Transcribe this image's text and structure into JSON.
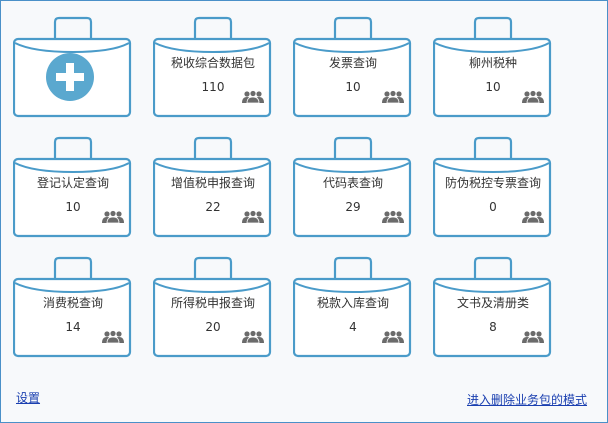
{
  "colors": {
    "outline": "#4a9bc9",
    "plus_bg": "#5aa8cf",
    "people": "#6b6b6b"
  },
  "add_package": {
    "icon": "plus-icon"
  },
  "packages": [
    {
      "name": "税收综合数据包",
      "count": "110"
    },
    {
      "name": "发票查询",
      "count": "10"
    },
    {
      "name": "柳州税种",
      "count": "10"
    },
    {
      "name": "登记认定查询",
      "count": "10"
    },
    {
      "name": "增值税申报查询",
      "count": "22"
    },
    {
      "name": "代码表查询",
      "count": "29"
    },
    {
      "name": "防伪税控专票查询",
      "count": "0"
    },
    {
      "name": "消费税查询",
      "count": "14"
    },
    {
      "name": "所得税申报查询",
      "count": "20"
    },
    {
      "name": "税款入库查询",
      "count": "4"
    },
    {
      "name": "文书及清册类",
      "count": "8"
    }
  ],
  "footer": {
    "settings": "设置",
    "delete_mode": "进入删除业务包的模式"
  }
}
